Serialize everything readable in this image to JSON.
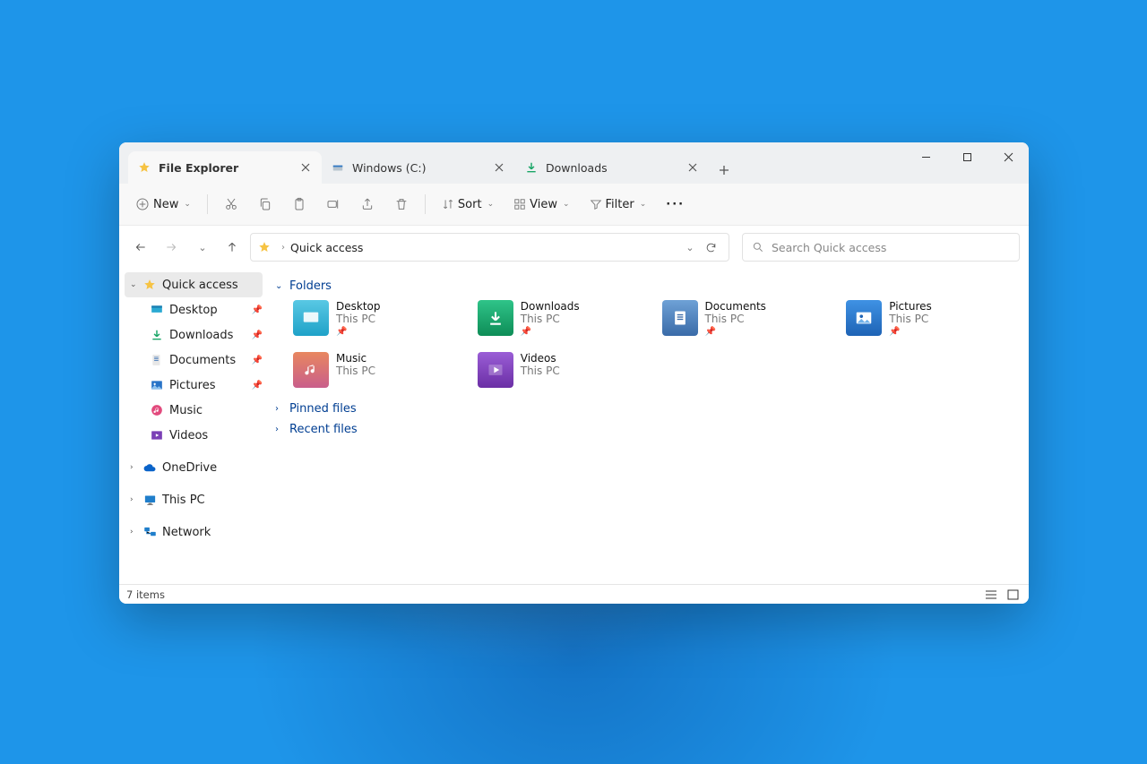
{
  "tabs": [
    {
      "label": "File Explorer",
      "icon": "star"
    },
    {
      "label": "Windows (C:)",
      "icon": "drive"
    },
    {
      "label": "Downloads",
      "icon": "download"
    }
  ],
  "toolbar": {
    "new": "New",
    "sort": "Sort",
    "view": "View",
    "filter": "Filter"
  },
  "breadcrumb": {
    "root": "Quick access"
  },
  "search": {
    "placeholder": "Search Quick access"
  },
  "sidebar": {
    "quick": "Quick access",
    "items": [
      {
        "label": "Desktop",
        "icon": "desktop",
        "pinned": true
      },
      {
        "label": "Downloads",
        "icon": "download",
        "pinned": true
      },
      {
        "label": "Documents",
        "icon": "document",
        "pinned": true
      },
      {
        "label": "Pictures",
        "icon": "pictures",
        "pinned": true
      },
      {
        "label": "Music",
        "icon": "music",
        "pinned": false
      },
      {
        "label": "Videos",
        "icon": "videos",
        "pinned": false
      }
    ],
    "onedrive": "OneDrive",
    "thispc": "This PC",
    "network": "Network"
  },
  "groups": {
    "folders": "Folders",
    "pinned": "Pinned files",
    "recent": "Recent files"
  },
  "folders": [
    {
      "name": "Desktop",
      "loc": "This PC",
      "icon": "desktop",
      "color": "#1fb6d9"
    },
    {
      "name": "Downloads",
      "loc": "This PC",
      "icon": "download",
      "color": "#18a566"
    },
    {
      "name": "Documents",
      "loc": "This PC",
      "icon": "document",
      "color": "#3e7bbf"
    },
    {
      "name": "Pictures",
      "loc": "This PC",
      "icon": "pictures",
      "color": "#1f6fd0"
    },
    {
      "name": "Music",
      "loc": "This PC",
      "icon": "music",
      "color": "#d87a4a"
    },
    {
      "name": "Videos",
      "loc": "This PC",
      "icon": "videos",
      "color": "#7a3fb5"
    }
  ],
  "status": {
    "text": "7 items"
  }
}
